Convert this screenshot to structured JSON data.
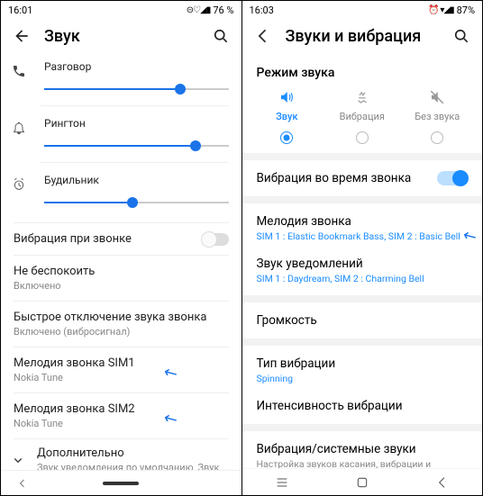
{
  "left": {
    "status": {
      "time": "16:01",
      "battery": "76 %",
      "icons": "⊝♡◢▮"
    },
    "header": {
      "title": "Звук"
    },
    "sliders": {
      "talk": {
        "label": "Разговор",
        "pct": 74
      },
      "ringtone": {
        "label": "Рингтон",
        "pct": 82
      },
      "alarm": {
        "label": "Будильник",
        "pct": 48
      }
    },
    "vibrate_on_call": {
      "title": "Вибрация при звонке"
    },
    "dnd": {
      "title": "Не беспокоить",
      "sub": "Включено"
    },
    "quick_mute": {
      "title": "Быстрое отключение звука звонка",
      "sub": "Включено (вибросигнал)"
    },
    "sim1": {
      "title": "Мелодия звонка SIM1",
      "sub": "Nokia Tune"
    },
    "sim2": {
      "title": "Мелодия звонка SIM2",
      "sub": "Nokia Tune"
    },
    "more": {
      "title": "Дополнительно",
      "sub": "Звук уведомления по умолчанию, Звук буди..."
    }
  },
  "right": {
    "status": {
      "time": "16:03",
      "battery": "87%",
      "icons": "⏰ ▾◢▮"
    },
    "header": {
      "title": "Звуки и вибрация"
    },
    "sound_mode": {
      "section": "Режим звука",
      "sound": "Звук",
      "vibration": "Вибрация",
      "silent": "Без звука"
    },
    "vibrate_ring": {
      "title": "Вибрация во время звонка"
    },
    "ringtone": {
      "title": "Мелодия звонка",
      "sub": "SIM 1 : Elastic Bookmark Bass, SIM 2 : Basic Bell"
    },
    "notif": {
      "title": "Звук уведомлений",
      "sub": "SIM 1 : Daydream, SIM 2 : Charming Bell"
    },
    "volume": {
      "title": "Громкость"
    },
    "vib_type": {
      "title": "Тип вибрации",
      "sub": "Spinning"
    },
    "vib_intensity": {
      "title": "Интенсивность вибрации"
    },
    "system": {
      "title": "Вибрация/системные звуки",
      "sub": "Настройка звуков касания, вибрации и отклика клавиатуры."
    }
  }
}
